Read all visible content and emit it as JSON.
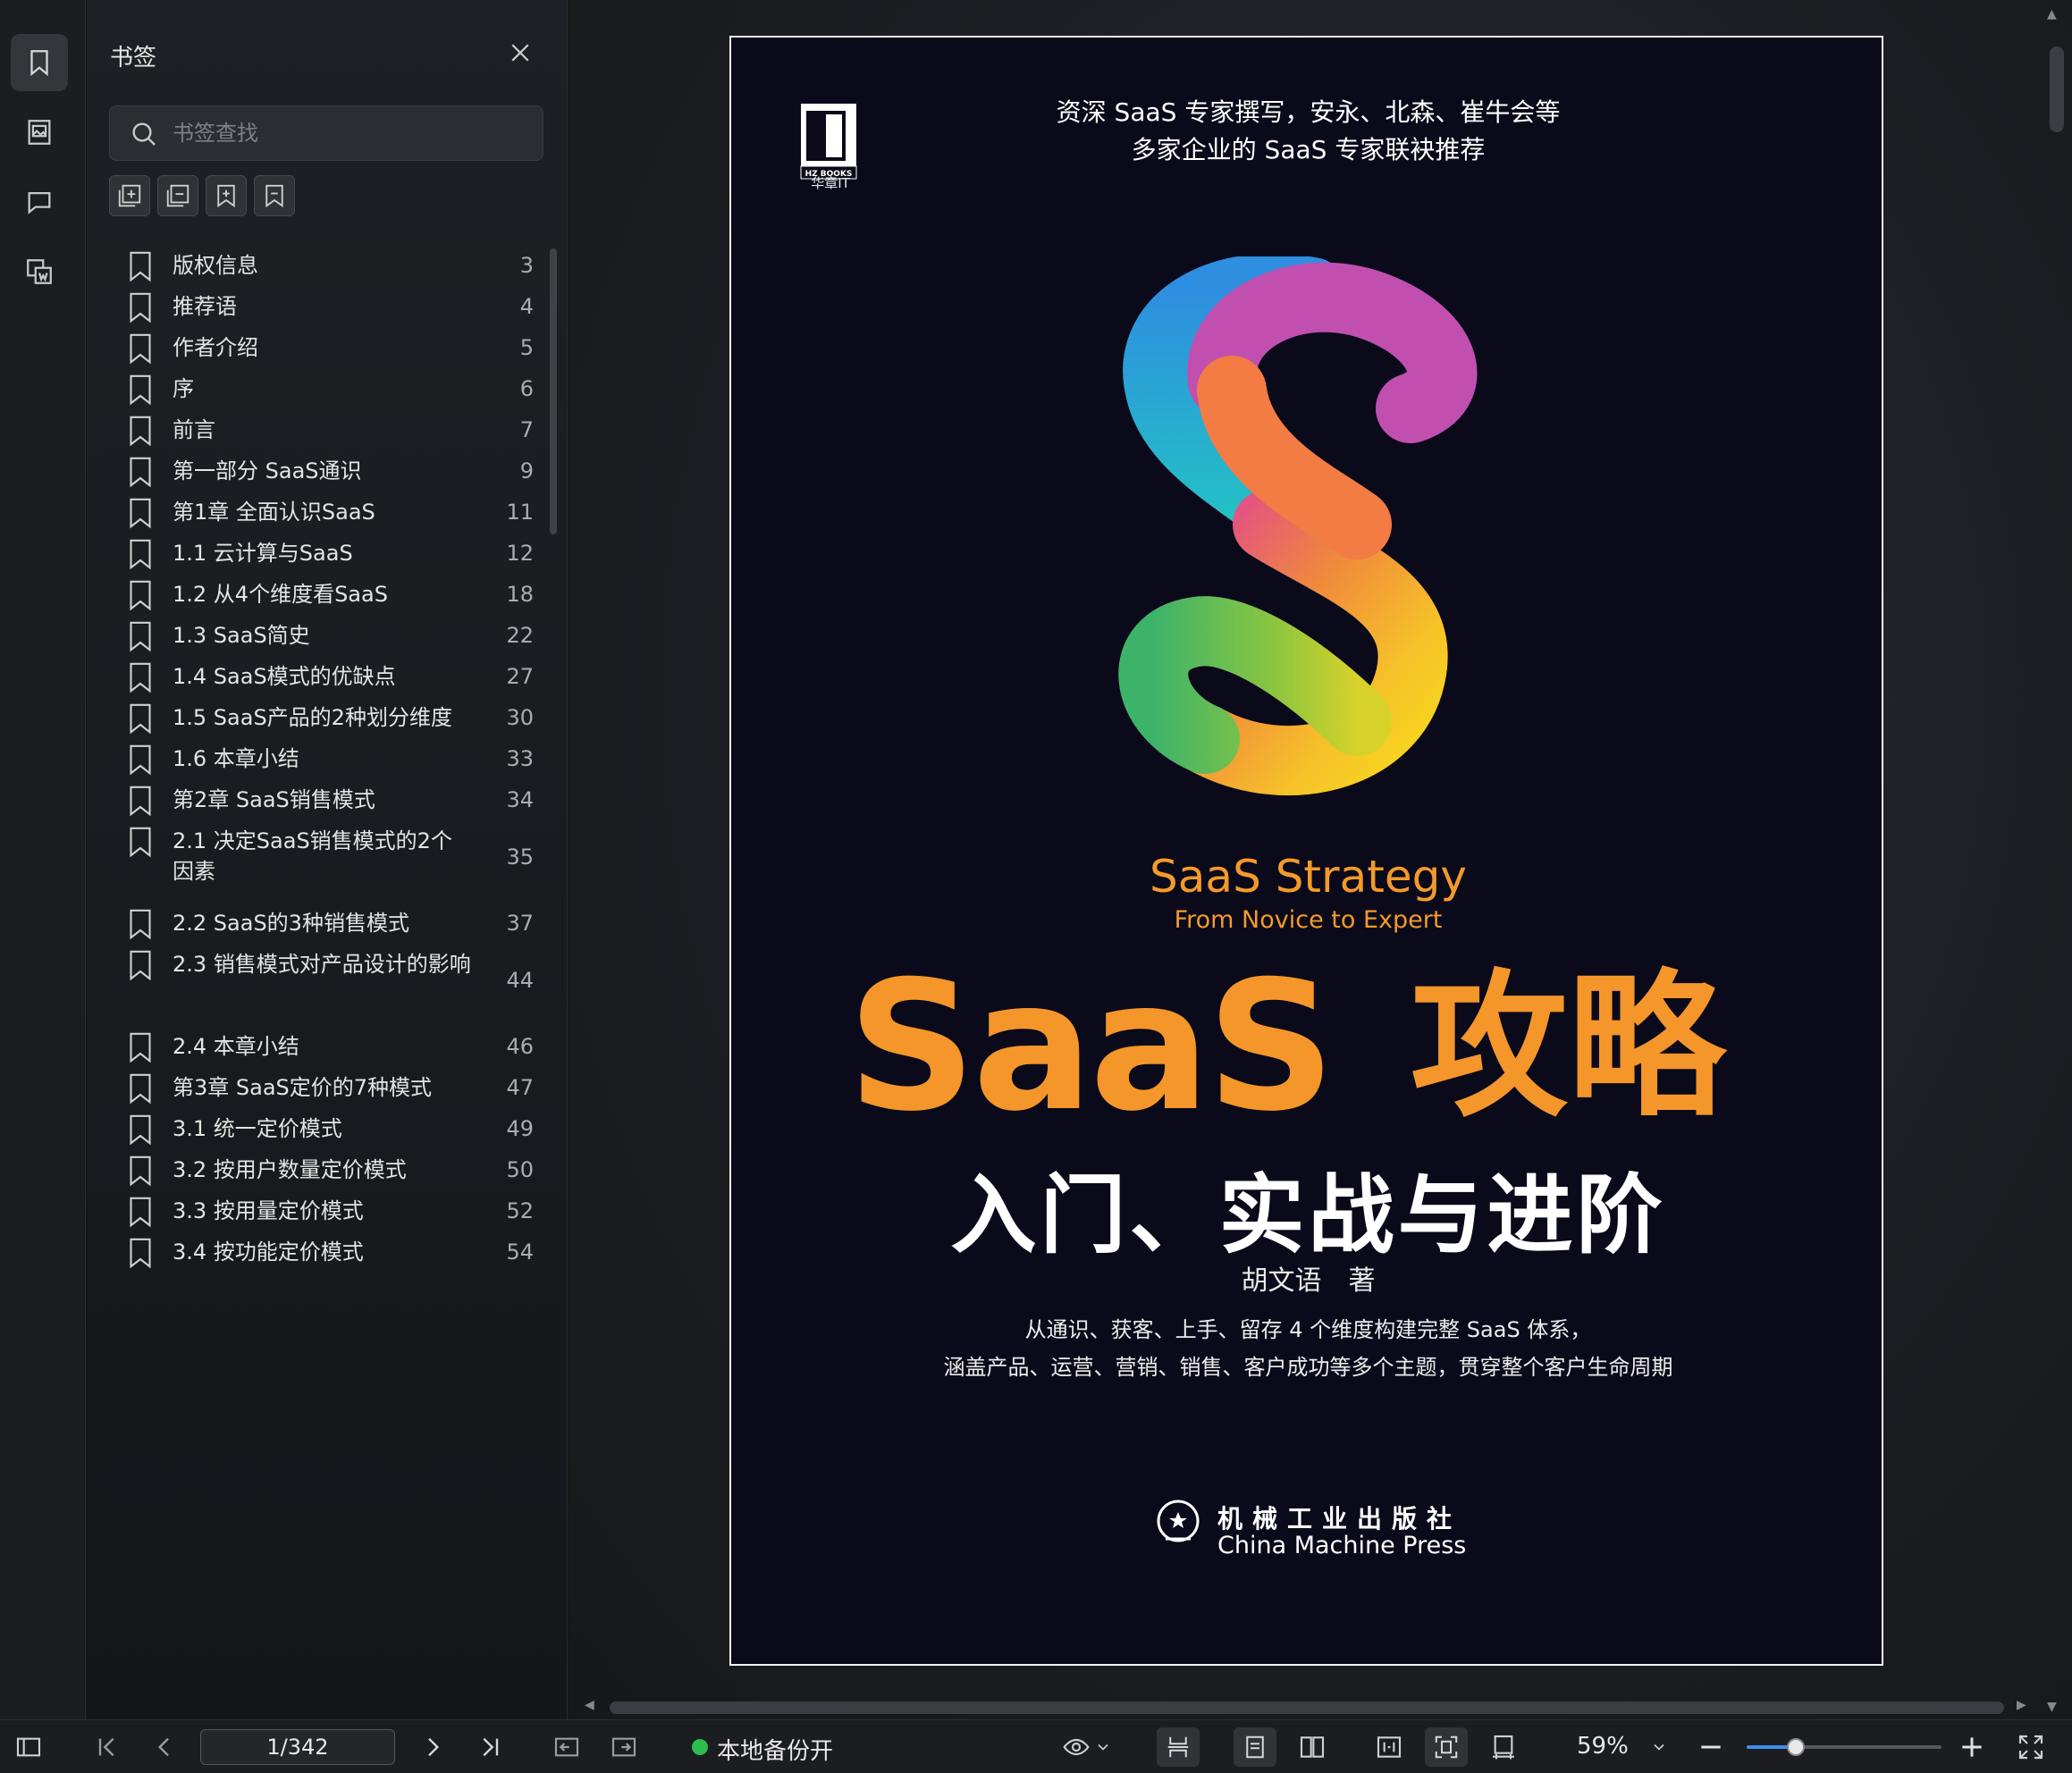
{
  "panel": {
    "title": "书签",
    "search_placeholder": "书签查找"
  },
  "bookmarks": [
    {
      "label": "版权信息",
      "page": "3"
    },
    {
      "label": "推荐语",
      "page": "4"
    },
    {
      "label": "作者介绍",
      "page": "5"
    },
    {
      "label": "序",
      "page": "6"
    },
    {
      "label": "前言",
      "page": "7"
    },
    {
      "label": "第一部分 SaaS通识",
      "page": "9"
    },
    {
      "label": "第1章 全面认识SaaS",
      "page": "11"
    },
    {
      "label": "1.1 云计算与SaaS",
      "page": "12"
    },
    {
      "label": "1.2 从4个维度看SaaS",
      "page": "18"
    },
    {
      "label": "1.3 SaaS简史",
      "page": "22"
    },
    {
      "label": "1.4 SaaS模式的优缺点",
      "page": "27"
    },
    {
      "label": "1.5 SaaS产品的2种划分维度",
      "page": "30"
    },
    {
      "label": "1.6 本章小结",
      "page": "33"
    },
    {
      "label": "第2章 SaaS销售模式",
      "page": "34"
    },
    {
      "label": "2.1 决定SaaS销售模式的2个因素",
      "page": "35"
    },
    {
      "label": "2.2 SaaS的3种销售模式",
      "page": "37"
    },
    {
      "label": "2.3 销售模式对产品设计的影响",
      "page": "44"
    },
    {
      "label": "2.4 本章小结",
      "page": "46"
    },
    {
      "label": "第3章 SaaS定价的7种模式",
      "page": "47"
    },
    {
      "label": "3.1 统一定价模式",
      "page": "49"
    },
    {
      "label": "3.2 按用户数量定价模式",
      "page": "50"
    },
    {
      "label": "3.3 按用量定价模式",
      "page": "52"
    },
    {
      "label": "3.4 按功能定价模式",
      "page": "54"
    }
  ],
  "cover": {
    "publisher_logo_text": "华章IT",
    "publisher_logo_small": "HZ BOOKS",
    "recommend_line1": "资深 SaaS 专家撰写，安永、北森、崔牛会等",
    "recommend_line2": "多家企业的 SaaS 专家联袂推荐",
    "en_title": "SaaS Strategy",
    "en_subtitle": "From Novice to Expert",
    "cn_title_en": "SaaS",
    "cn_title_cn": "攻略",
    "cn_subtitle": "入门、实战与进阶",
    "author": "胡文语　著",
    "desc_line1": "从通识、获客、上手、留存 4 个维度构建完整 SaaS 体系，",
    "desc_line2": "涵盖产品、运营、营销、销售、客户成功等多个主题，贯穿整个客户生命周期",
    "press_cn": "机械工业出版社",
    "press_en": "China Machine Press"
  },
  "toolbar": {
    "page_indicator": "1/342",
    "backup_status": "本地备份开",
    "zoom": "59%",
    "zoom_fraction": 0.25
  },
  "colors": {
    "accent_orange": "#f4962a",
    "cover_bg": "#0b0a1b",
    "backup_green": "#2dbd4e",
    "slider_blue": "#3d8ef0"
  }
}
